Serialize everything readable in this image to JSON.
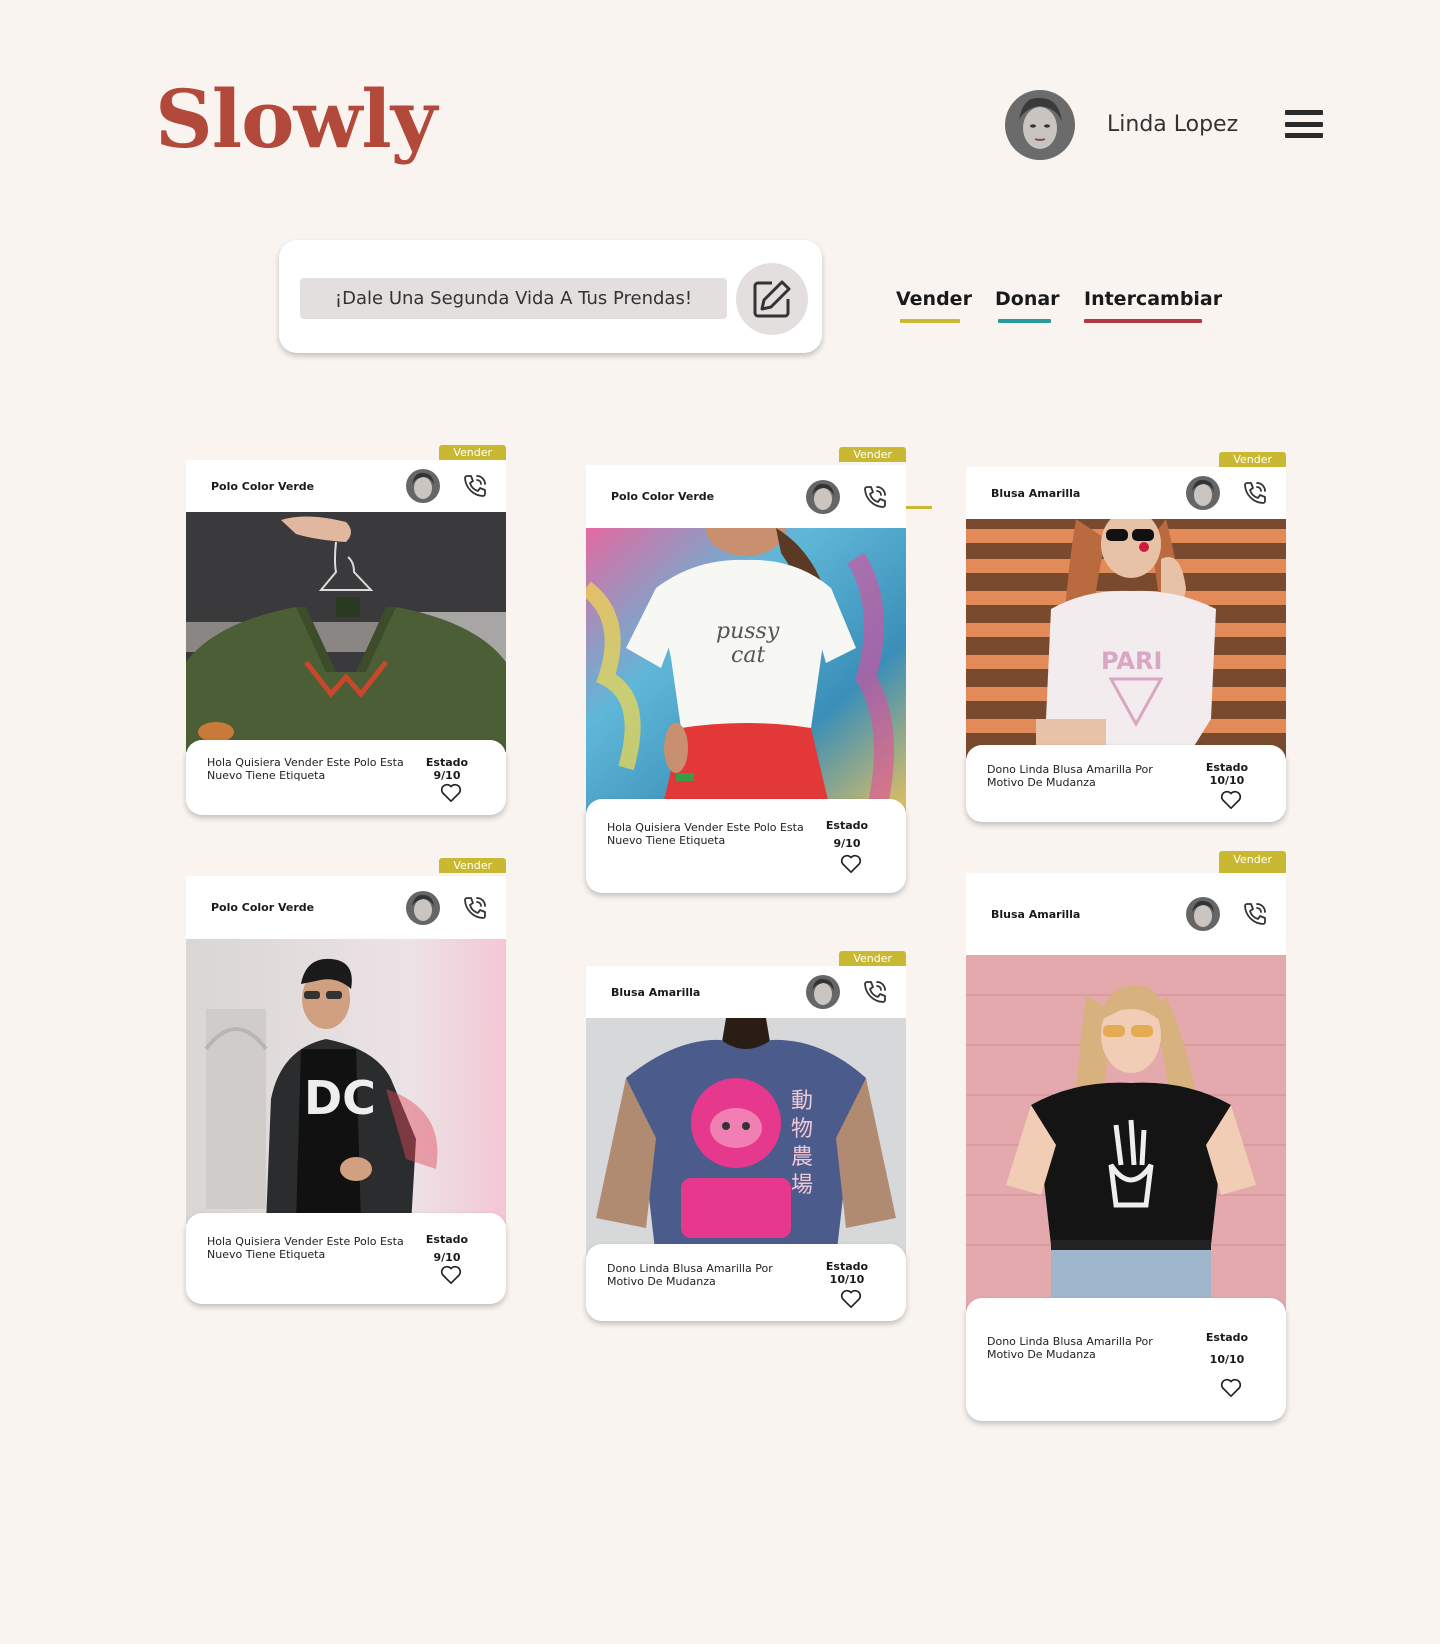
{
  "header": {
    "logo": "Slowly",
    "user_name": "Linda Lopez"
  },
  "search": {
    "text": "¡Dale Una Segunda Vida A Tus Prendas!"
  },
  "tabs": [
    {
      "label": "Vender",
      "color": "#c8b832"
    },
    {
      "label": "Donar",
      "color": "#2a9a9a"
    },
    {
      "label": "Intercambiar",
      "color": "#b03a43"
    }
  ],
  "cards": [
    {
      "tag": "Vender",
      "title": "Polo Color Verde",
      "desc": "Hola Quisiera Vender Este Polo Esta Nuevo Tiene  Etiqueta",
      "estado_label": "Estado",
      "estado_value": "9/10"
    },
    {
      "tag": "Vender",
      "title": "Polo Color Verde",
      "desc": "Hola Quisiera Vender Este Polo Esta Nuevo Tiene  Etiqueta",
      "estado_label": "Estado",
      "estado_value": "9/10"
    },
    {
      "tag": "Vender",
      "title": "Blusa Amarilla",
      "desc": "Dono Linda Blusa Amarilla Por Motivo De Mudanza",
      "estado_label": "Estado",
      "estado_value": "10/10"
    },
    {
      "tag": "Vender",
      "title": "Polo Color Verde",
      "desc": "Hola Quisiera Vender Este Polo Esta Nuevo Tiene  Etiqueta",
      "estado_label": "Estado",
      "estado_value": "9/10"
    },
    {
      "tag": "Vender",
      "title": "Blusa Amarilla",
      "desc": "Dono Linda Blusa Amarilla Por Motivo De Mudanza",
      "estado_label": "Estado",
      "estado_value": "10/10"
    },
    {
      "tag": "Vender",
      "title": "Blusa Amarilla",
      "desc": "Dono Linda Blusa Amarilla Por Motivo De Mudanza",
      "estado_label": "Estado",
      "estado_value": "10/10"
    }
  ],
  "icons": {
    "menu": "hamburger-icon",
    "edit": "edit-icon",
    "phone": "phone-call-icon",
    "heart": "heart-icon"
  },
  "colors": {
    "background": "#f9f4f0",
    "logo": "#b2493a",
    "tag": "#c8b832",
    "vender": "#c8b832",
    "donar": "#2a9a9a",
    "intercambiar": "#b03a43"
  }
}
